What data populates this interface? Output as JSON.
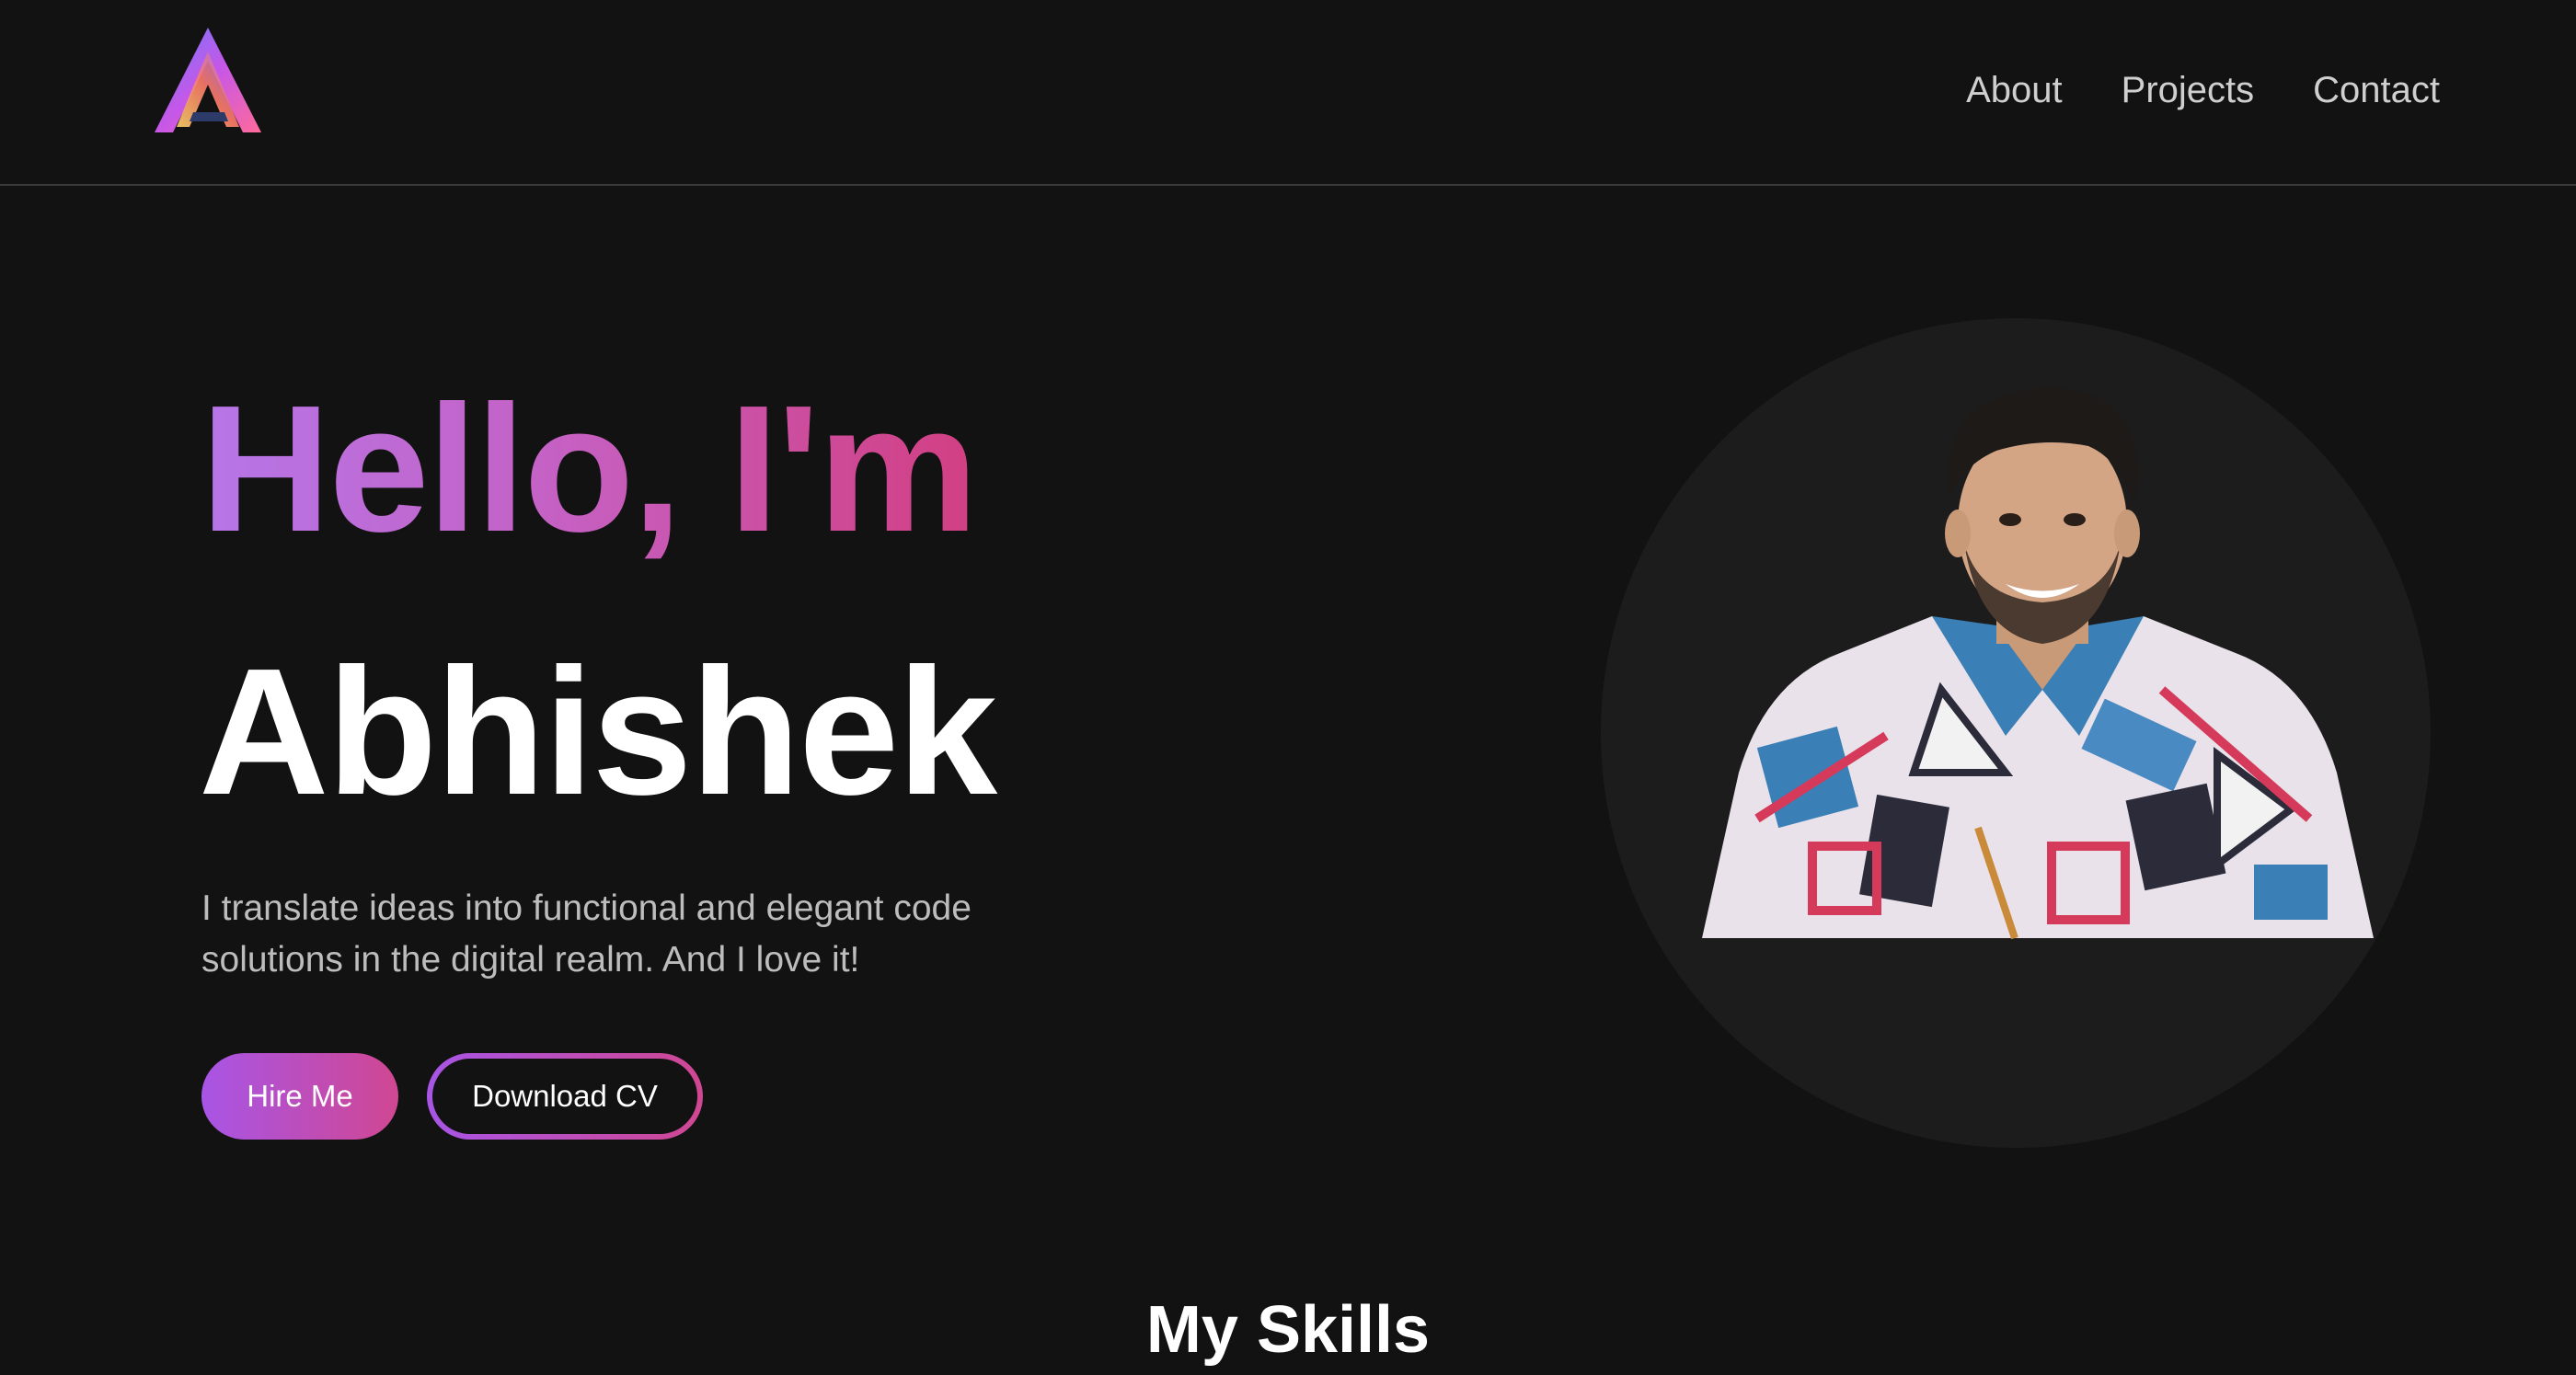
{
  "nav": {
    "items": [
      "About",
      "Projects",
      "Contact"
    ]
  },
  "hero": {
    "greeting": "Hello, I'm",
    "name": "Abhishek",
    "tagline_line1": "I translate ideas into functional and elegant code",
    "tagline_line2": "solutions in the digital realm. And I love it!",
    "hire_label": "Hire Me",
    "cv_label": "Download CV"
  },
  "skills": {
    "title": "My Skills"
  },
  "colors": {
    "background": "#121212",
    "accent_start": "#a855e6",
    "accent_end": "#d04792",
    "nav_text": "#cfcfcf"
  },
  "icons": {
    "logo": "gradient-a-logo"
  }
}
